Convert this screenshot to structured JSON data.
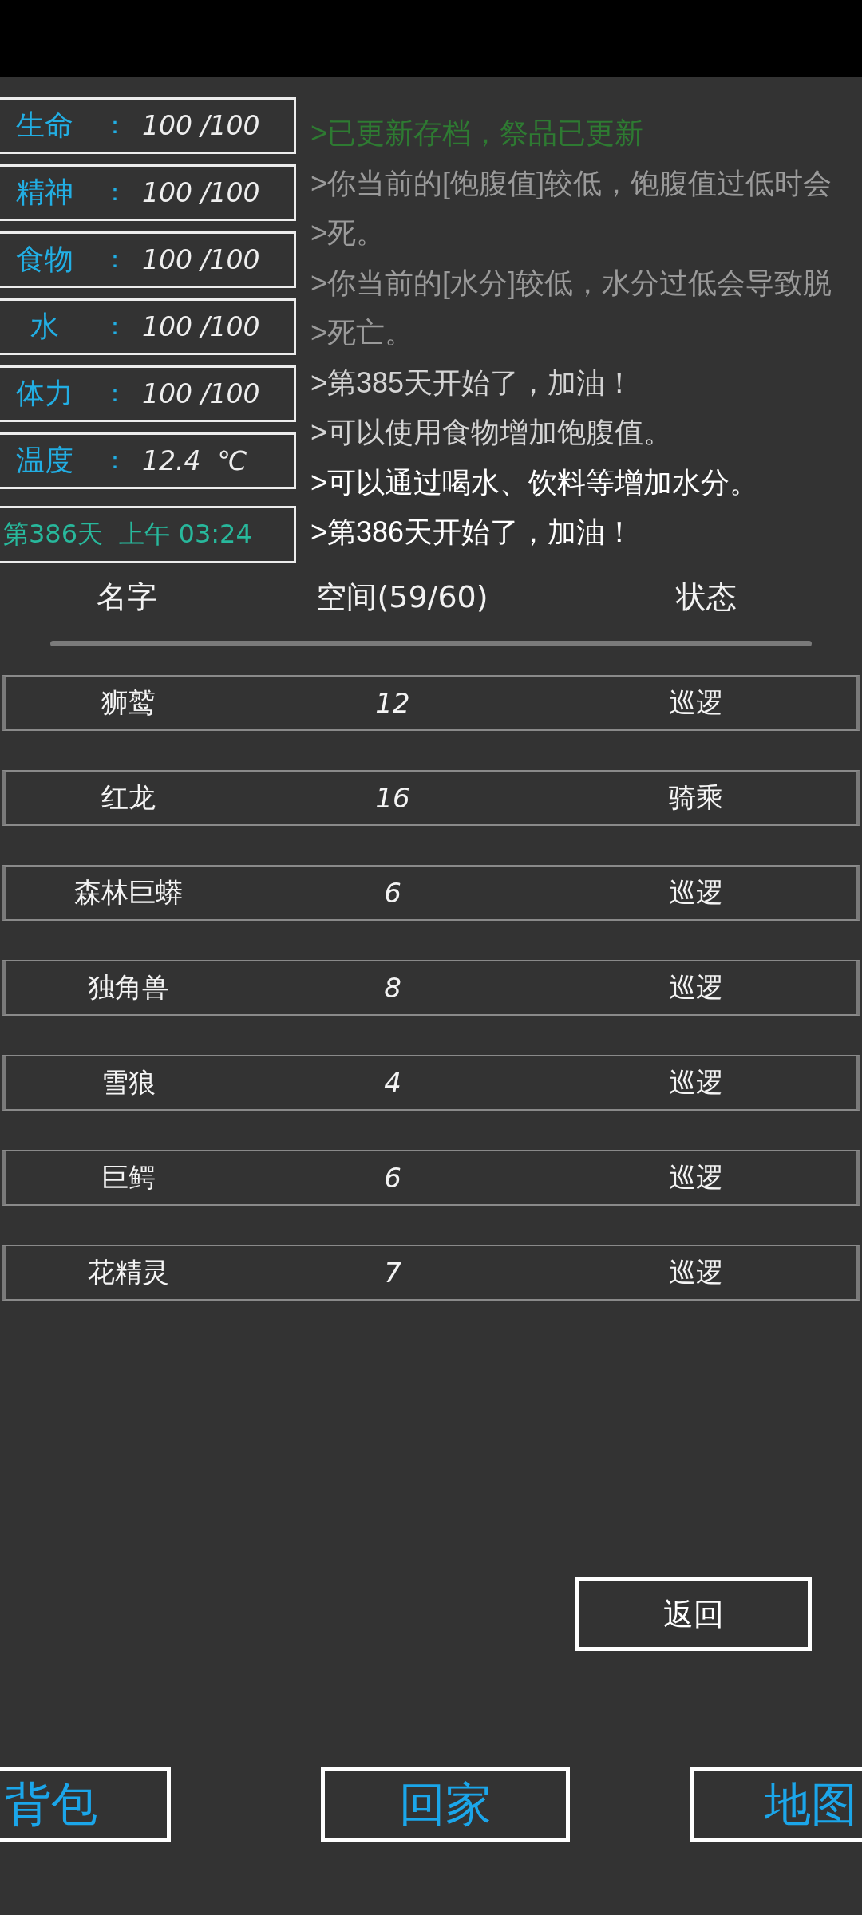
{
  "stats": [
    {
      "label": "生命",
      "separator": "：",
      "value": "100 /100"
    },
    {
      "label": "精神",
      "separator": "：",
      "value": "100 /100"
    },
    {
      "label": "食物",
      "separator": "：",
      "value": "100 /100"
    },
    {
      "label": "水",
      "separator": "：",
      "value": "100 /100"
    },
    {
      "label": "体力",
      "separator": "：",
      "value": "100 /100"
    },
    {
      "label": "温度",
      "separator": "：",
      "value": "12.4  ℃"
    }
  ],
  "clock": {
    "text": "第386天  上午 03:24"
  },
  "log": [
    {
      "text": ">已更新存档，祭品已更新",
      "color": "#2e7a32"
    },
    {
      "text": ">你当前的[饱腹值]较低，饱腹值过低时会",
      "color": "#9a9a9a"
    },
    {
      "text": ">死。",
      "color": "#9a9a9a"
    },
    {
      "text": ">你当前的[水分]较低，水分过低会导致脱",
      "color": "#9a9a9a"
    },
    {
      "text": ">死亡。",
      "color": "#9a9a9a"
    },
    {
      "text": ">第385天开始了，加油！",
      "color": "#d4d4d4"
    },
    {
      "text": ">可以使用食物增加饱腹值。",
      "color": "#d4d4d4"
    },
    {
      "text": ">可以通过喝水、饮料等增加水分。",
      "color": "#ffffff"
    },
    {
      "text": ">第386天开始了，加油！",
      "color": "#ffffff"
    }
  ],
  "table": {
    "columns": [
      "名字",
      "空间(59/60)",
      "状态"
    ],
    "rows": [
      {
        "name": "狮鹫",
        "space": "12",
        "status": "巡逻"
      },
      {
        "name": "红龙",
        "space": "16",
        "status": "骑乘"
      },
      {
        "name": "森林巨蟒",
        "space": "6",
        "status": "巡逻"
      },
      {
        "name": "独角兽",
        "space": "8",
        "status": "巡逻"
      },
      {
        "name": "雪狼",
        "space": "4",
        "status": "巡逻"
      },
      {
        "name": "巨鳄",
        "space": "6",
        "status": "巡逻"
      },
      {
        "name": "花精灵",
        "space": "7",
        "status": "巡逻"
      }
    ]
  },
  "return_button": "返回",
  "nav_buttons": [
    "背包",
    "回家",
    "地图"
  ]
}
